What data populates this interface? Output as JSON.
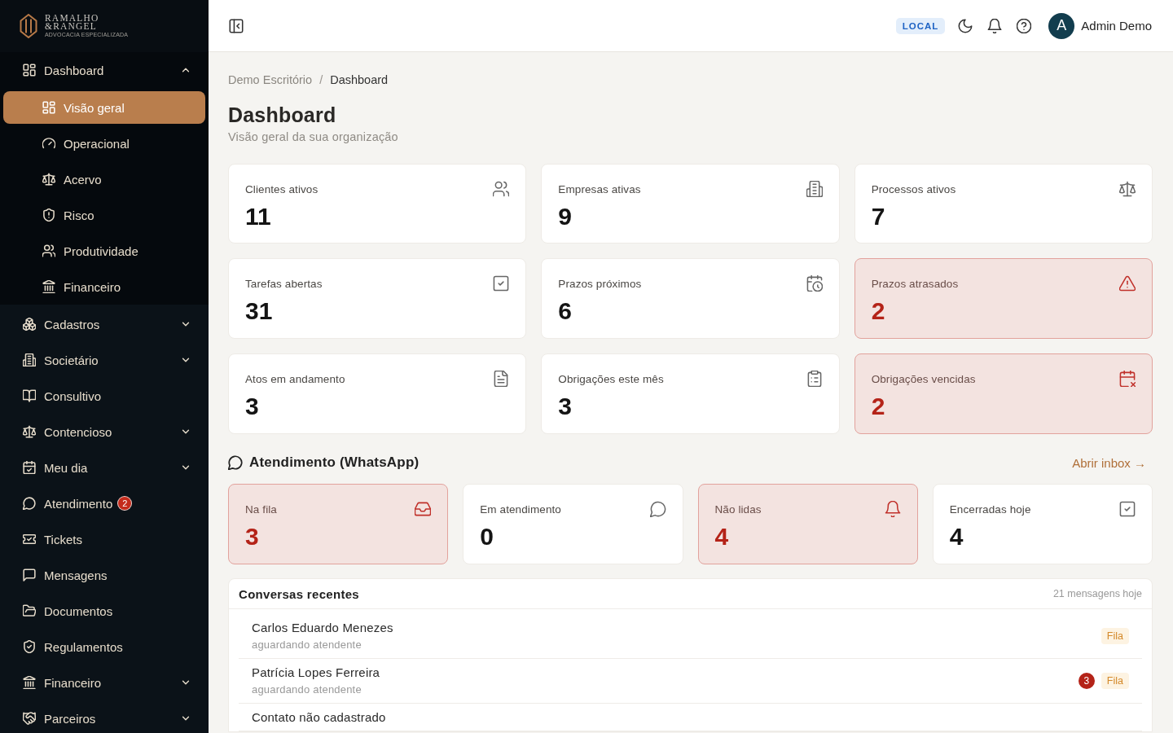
{
  "logo": {
    "line_1": "RAMALHO",
    "line_2": "&RANGEL",
    "tagline": "ADVOCACIA ESPECIALIZADA"
  },
  "sidebar": {
    "items": [
      {
        "label": "Dashboard",
        "kind": "group",
        "expanded": true,
        "selected": false,
        "children": [
          {
            "label": "Visão geral",
            "selected": true
          },
          {
            "label": "Operacional",
            "selected": false
          },
          {
            "label": "Acervo",
            "selected": false
          },
          {
            "label": "Risco",
            "selected": false
          },
          {
            "label": "Produtividade",
            "selected": false
          },
          {
            "label": "Financeiro",
            "selected": false
          }
        ]
      },
      {
        "label": "Cadastros",
        "kind": "group",
        "expanded": false,
        "selected": false
      },
      {
        "label": "Societário",
        "kind": "group",
        "expanded": false,
        "selected": false
      },
      {
        "label": "Consultivo",
        "kind": "link",
        "selected": false
      },
      {
        "label": "Contencioso",
        "kind": "group",
        "expanded": false,
        "selected": false
      },
      {
        "label": "Meu dia",
        "kind": "group",
        "expanded": false,
        "selected": false
      },
      {
        "label": "Atendimento",
        "kind": "link",
        "selected": false,
        "badge": "2"
      },
      {
        "label": "Tickets",
        "kind": "link",
        "selected": false
      },
      {
        "label": "Mensagens",
        "kind": "link",
        "selected": false
      },
      {
        "label": "Documentos",
        "kind": "link",
        "selected": false
      },
      {
        "label": "Regulamentos",
        "kind": "link",
        "selected": false
      },
      {
        "label": "Financeiro",
        "kind": "group",
        "expanded": false,
        "selected": false
      },
      {
        "label": "Parceiros",
        "kind": "group",
        "expanded": false,
        "selected": false
      }
    ]
  },
  "header": {
    "environment_badge": "LOCAL",
    "user": {
      "avatar_initial": "A",
      "name": "Admin Demo"
    }
  },
  "breadcrumb": {
    "separator": "/",
    "items": [
      {
        "label": "Demo Escritório",
        "current": false
      },
      {
        "label": "Dashboard",
        "current": true
      }
    ]
  },
  "page": {
    "title": "Dashboard",
    "subtitle": "Visão geral da sua organização"
  },
  "stats": [
    {
      "label": "Clientes ativos",
      "value": "11",
      "alert": false
    },
    {
      "label": "Empresas ativas",
      "value": "9",
      "alert": false
    },
    {
      "label": "Processos ativos",
      "value": "7",
      "alert": false
    },
    {
      "label": "Tarefas abertas",
      "value": "31",
      "alert": false
    },
    {
      "label": "Prazos próximos",
      "value": "6",
      "alert": false
    },
    {
      "label": "Prazos atrasados",
      "value": "2",
      "alert": true
    },
    {
      "label": "Atos em andamento",
      "value": "3",
      "alert": false
    },
    {
      "label": "Obrigações este mês",
      "value": "3",
      "alert": false
    },
    {
      "label": "Obrigações vencidas",
      "value": "2",
      "alert": true
    }
  ],
  "atendimento": {
    "title": "Atendimento (WhatsApp)",
    "link": "Abrir inbox →",
    "stats": [
      {
        "label": "Na fila",
        "value": "3",
        "alert": true
      },
      {
        "label": "Em atendimento",
        "value": "0",
        "alert": false
      },
      {
        "label": "Não lidas",
        "value": "4",
        "alert": true
      },
      {
        "label": "Encerradas hoje",
        "value": "4",
        "alert": false
      }
    ]
  },
  "recent_conversations": {
    "title": "Conversas recentes",
    "summary": "21 mensagens hoje",
    "rows": [
      {
        "name": "Carlos Eduardo Menezes",
        "status": "aguardando atendente",
        "tag": "Fila"
      },
      {
        "name": "Patrícia Lopes Ferreira",
        "status": "aguardando atendente",
        "unread": "3",
        "tag": "Fila"
      },
      {
        "name": "Contato não cadastrado"
      }
    ]
  }
}
